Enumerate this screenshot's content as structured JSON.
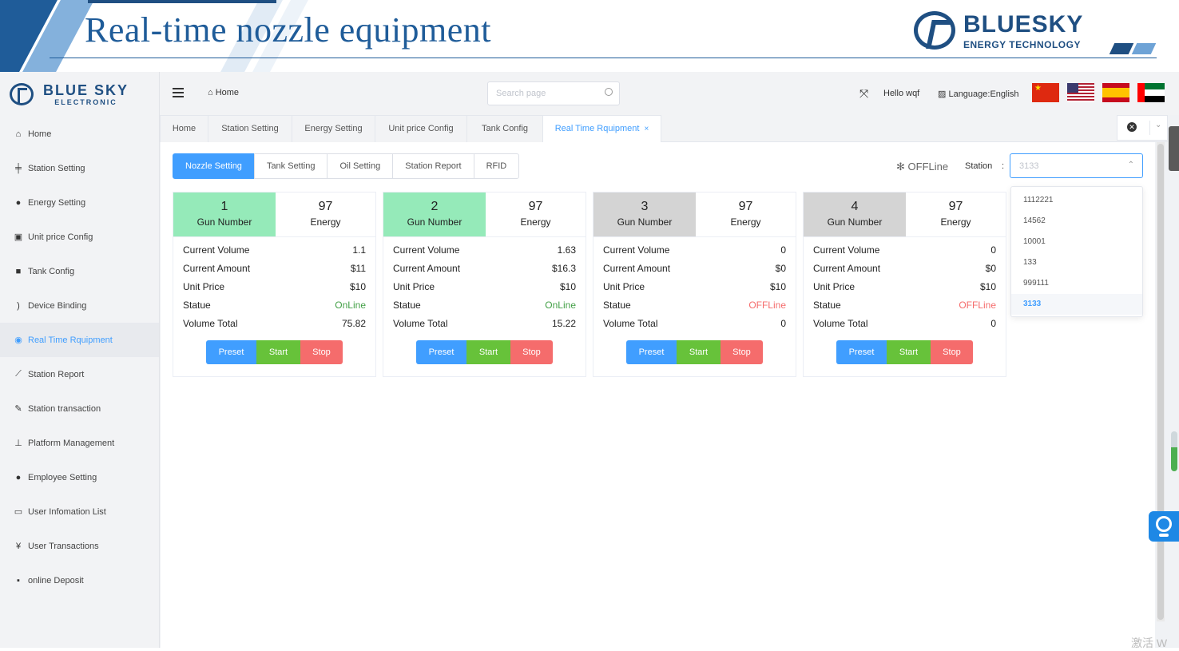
{
  "slide": {
    "title": "Real-time nozzle equipment",
    "brand": "BLUESKY",
    "brand_sub": "ENERGY TECHNOLOGY"
  },
  "sidebar": {
    "logo_main": "BLUE SKY",
    "logo_sub": "ELECTRONIC",
    "items": [
      {
        "label": "Home",
        "icon": "home-icon"
      },
      {
        "label": "Station Setting",
        "icon": "sliders-icon"
      },
      {
        "label": "Energy Setting",
        "icon": "drop-icon"
      },
      {
        "label": "Unit price Config",
        "icon": "money-icon"
      },
      {
        "label": "Tank Config",
        "icon": "square-icon"
      },
      {
        "label": "Device Binding",
        "icon": "signal-icon"
      },
      {
        "label": "Real Time Rquipment",
        "icon": "dashboard-icon"
      },
      {
        "label": "Station Report",
        "icon": "chart-icon"
      },
      {
        "label": "Station transaction",
        "icon": "gavel-icon"
      },
      {
        "label": "Platform Management",
        "icon": "sitemap-icon"
      },
      {
        "label": "Employee Setting",
        "icon": "user-icon"
      },
      {
        "label": "User Infomation List",
        "icon": "card-icon"
      },
      {
        "label": "User Transactions",
        "icon": "yen-icon"
      },
      {
        "label": "online Deposit",
        "icon": "briefcase-icon"
      }
    ]
  },
  "header": {
    "breadcrumb": "Home",
    "search_placeholder": "Search page",
    "greeting": "Hello wqf",
    "language": "Language:English"
  },
  "tabs": [
    {
      "label": "Home"
    },
    {
      "label": "Station Setting"
    },
    {
      "label": "Energy Setting"
    },
    {
      "label": "Unit price Config"
    },
    {
      "label": "Tank Config"
    },
    {
      "label": "Real Time Rquipment",
      "close": "×"
    }
  ],
  "subtabs": [
    "Nozzle Setting",
    "Tank Setting",
    "Oil Setting",
    "Station Report",
    "RFID"
  ],
  "status": {
    "offline_label": "OFFLine",
    "station_label": "Station",
    "colon": ":",
    "station_value": "3133",
    "options": [
      "1112221",
      "14562",
      "10001",
      "133",
      "999111",
      "3133"
    ]
  },
  "labels": {
    "gun_number": "Gun Number",
    "energy": "Energy",
    "current_volume": "Current Volume",
    "current_amount": "Current Amount",
    "unit_price": "Unit Price",
    "statue": "Statue",
    "volume_total": "Volume Total",
    "preset": "Preset",
    "start": "Start",
    "stop": "Stop"
  },
  "nozzles": [
    {
      "gun": "1",
      "energy": "97",
      "volume": "1.1",
      "amount": "$11",
      "price": "$10",
      "status": "OnLine",
      "total": "75.82"
    },
    {
      "gun": "2",
      "energy": "97",
      "volume": "1.63",
      "amount": "$16.3",
      "price": "$10",
      "status": "OnLine",
      "total": "15.22"
    },
    {
      "gun": "3",
      "energy": "97",
      "volume": "0",
      "amount": "$0",
      "price": "$10",
      "status": "OFFLine",
      "total": "0"
    },
    {
      "gun": "4",
      "energy": "97",
      "volume": "0",
      "amount": "$0",
      "price": "$10",
      "status": "OFFLine",
      "total": "0"
    }
  ],
  "watermark": "激活 W"
}
